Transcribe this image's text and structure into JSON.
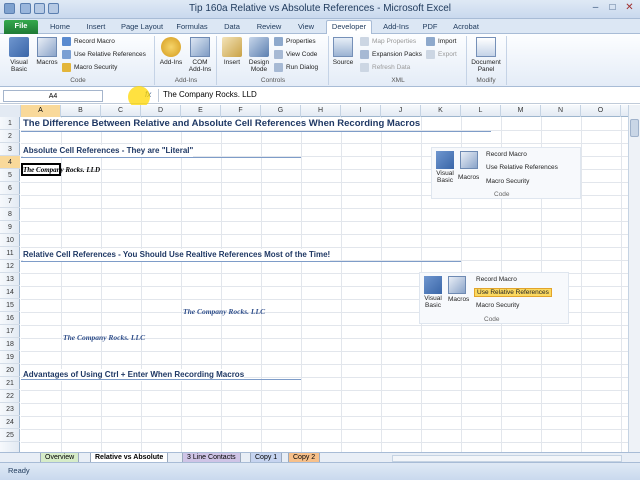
{
  "window": {
    "title": "Tip 160a  Relative vs Absolute References - Microsoft Excel"
  },
  "tabs": [
    "File",
    "Home",
    "Insert",
    "Page Layout",
    "Formulas",
    "Data",
    "Review",
    "View",
    "Developer",
    "Add-Ins",
    "PDF",
    "Acrobat"
  ],
  "ribbon": {
    "code": {
      "visual_basic": "Visual Basic",
      "macros": "Macros",
      "record_macro": "Record Macro",
      "use_relative": "Use Relative References",
      "macro_security": "Macro Security",
      "label": "Code"
    },
    "addins": {
      "addins": "Add-Ins",
      "com_addins": "COM Add-Ins",
      "label": "Add-Ins"
    },
    "controls": {
      "insert": "Insert",
      "design_mode": "Design Mode",
      "properties": "Properties",
      "view_code": "View Code",
      "run_dialog": "Run Dialog",
      "label": "Controls"
    },
    "xml": {
      "source": "Source",
      "map_properties": "Map Properties",
      "expansion_packs": "Expansion Packs",
      "refresh_data": "Refresh Data",
      "import": "Import",
      "export": "Export",
      "label": "XML"
    },
    "modify": {
      "document_panel": "Document Panel",
      "label": "Modify"
    }
  },
  "formula_bar": {
    "name_box": "A4",
    "fx": "fx",
    "value": "The Company Rocks. LLD"
  },
  "columns": [
    "A",
    "B",
    "C",
    "D",
    "E",
    "F",
    "G",
    "H",
    "I",
    "J",
    "K",
    "L",
    "M",
    "N",
    "O"
  ],
  "rows": [
    "1",
    "2",
    "3",
    "4",
    "5",
    "6",
    "7",
    "8",
    "9",
    "10",
    "11",
    "12",
    "13",
    "14",
    "15",
    "16",
    "17",
    "18",
    "19",
    "20",
    "21",
    "22",
    "23",
    "24",
    "25"
  ],
  "sheet": {
    "r1": "The Difference Between Relative and Absolute Cell References When Recording Macros",
    "r3": "Absolute Cell References - They are \"Literal\"",
    "r4": "The Company Rocks. LLD",
    "r11": "Relative Cell References - You Should Use Realtive References Most of the Time!",
    "r15": "The Company Rocks. LLC",
    "r17": "The Company Rocks. LLC",
    "r20": "Advantages of Using Ctrl + Enter When Recording Macros"
  },
  "panel1": {
    "visual_basic": "Visual Basic",
    "macros": "Macros",
    "record_macro": "Record Macro",
    "use_relative": "Use Relative References",
    "macro_security": "Macro Security",
    "label": "Code"
  },
  "panel2": {
    "visual_basic": "Visual Basic",
    "macros": "Macros",
    "record_macro": "Record Macro",
    "use_relative": "Use Relative References",
    "macro_security": "Macro Security",
    "label": "Code",
    "highlight_color": "#fbd960"
  },
  "sheet_tabs": [
    "Overview",
    "Relative vs Absolute",
    "3 Line Contacts",
    "Copy 1",
    "Copy 2"
  ],
  "status": {
    "text": "Ready"
  },
  "colors": {
    "accent": "#1f3864",
    "selection": "#f9d99a",
    "file_tab": "#2a8f40"
  }
}
